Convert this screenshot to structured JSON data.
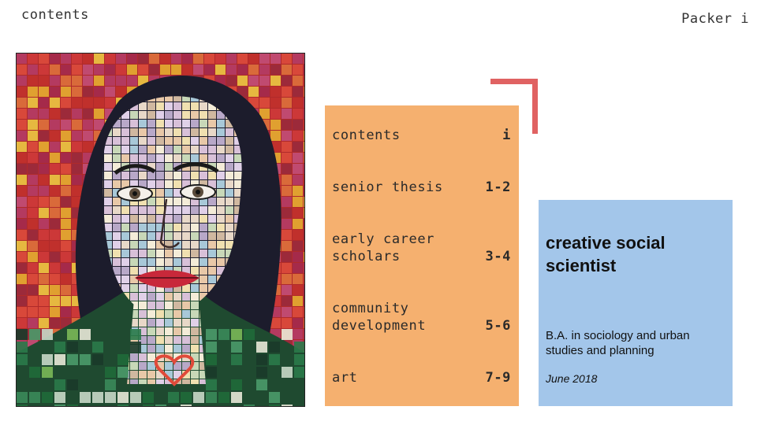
{
  "header": {
    "title": "contents",
    "page_label": "Packer i"
  },
  "portrait": {
    "icon": "portrait-painting",
    "background_color": "#b02a2a",
    "hair_color": "#1a1a2a"
  },
  "accent_color": "#e06262",
  "toc": {
    "background_color": "#f5b06f",
    "items": [
      {
        "label": "contents",
        "page": "i"
      },
      {
        "label": "senior thesis",
        "page": "1-2"
      },
      {
        "label": "early career\nscholars",
        "page": "3-4"
      },
      {
        "label": "community\ndevelopment",
        "page": "5-6"
      },
      {
        "label": "art",
        "page": "7-9"
      }
    ]
  },
  "info": {
    "background_color": "#a3c6ea",
    "title": "creative social scientist",
    "degree": "B.A. in sociology and urban studies and planning",
    "date": "June 2018"
  }
}
